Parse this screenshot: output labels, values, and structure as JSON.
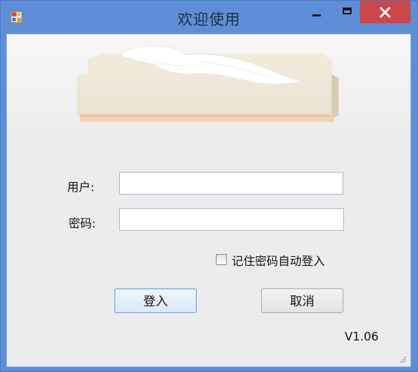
{
  "window": {
    "title": "欢迎使用",
    "icons": {
      "app": "app-icon",
      "minimize": "minimize-icon",
      "maximize": "maximize-icon",
      "close": "close-icon"
    },
    "colors": {
      "titlebar": "#5e8fd6",
      "close_button": "#c9474a",
      "client_bg": "#ececef"
    }
  },
  "banner": {
    "image": "tissue-box-image"
  },
  "form": {
    "username": {
      "label": "用户:",
      "value": ""
    },
    "password": {
      "label": "密码:",
      "value": ""
    },
    "remember": {
      "label": "记住密码自动登入",
      "checked": false
    },
    "login_button": "登入",
    "cancel_button": "取消",
    "version": "V1.06"
  }
}
